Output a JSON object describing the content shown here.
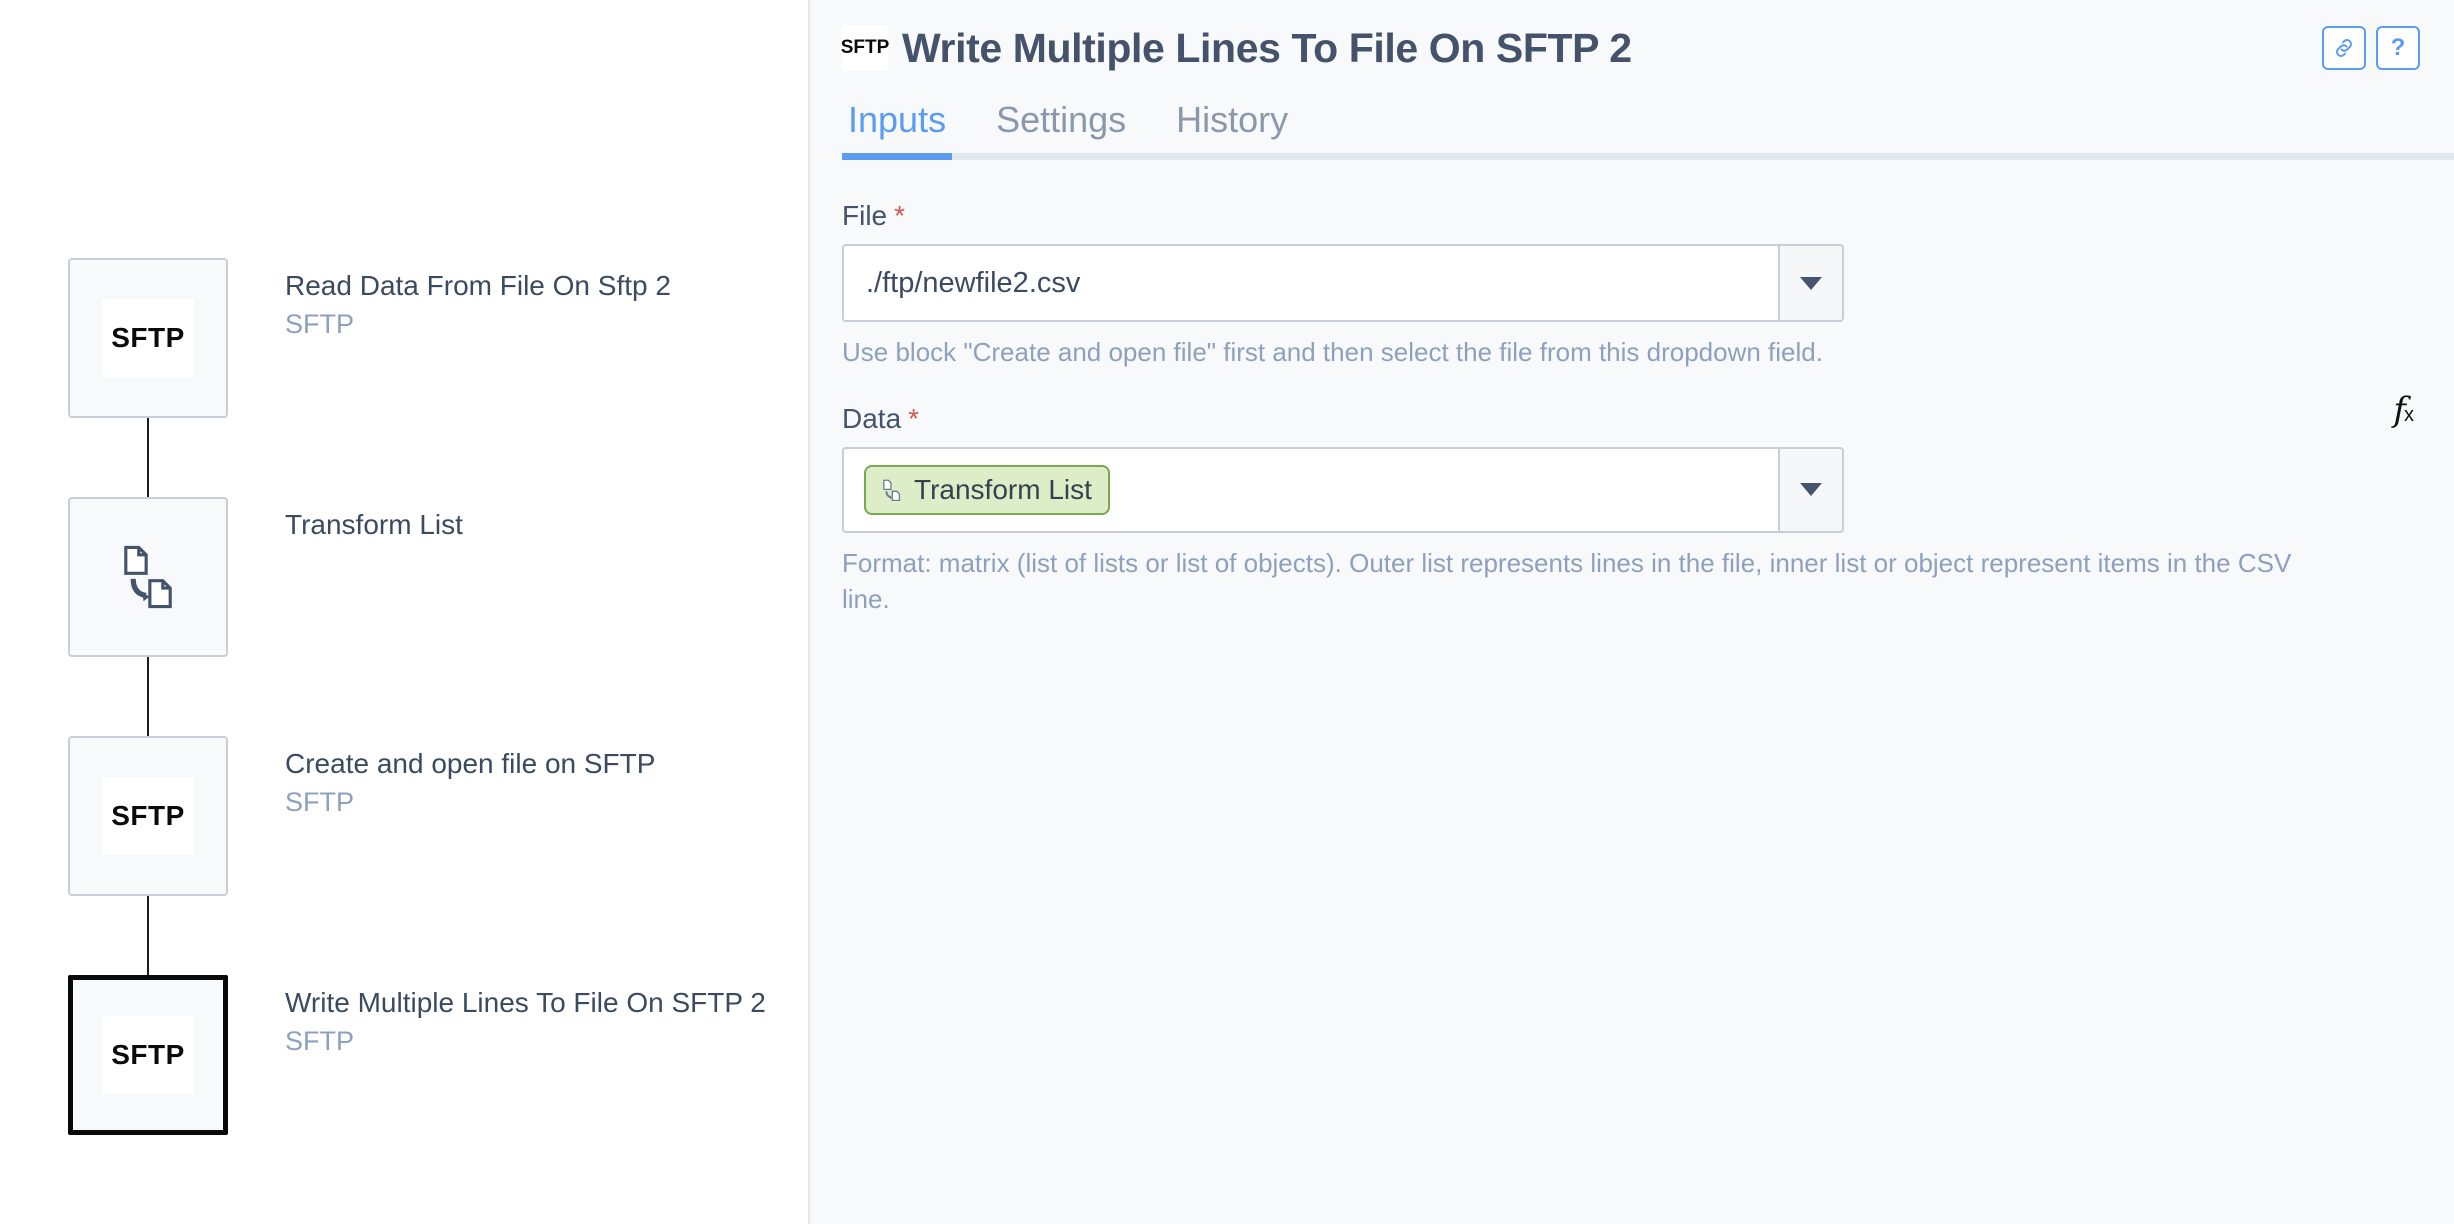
{
  "canvas": {
    "nodes": [
      {
        "icon": "sftp-badge-icon",
        "badge": "SFTP",
        "title": "Read Data From File On Sftp 2",
        "subtitle": "SFTP",
        "selected": false
      },
      {
        "icon": "transform-list-icon",
        "badge": "",
        "title": "Transform List",
        "subtitle": "",
        "selected": false
      },
      {
        "icon": "sftp-badge-icon",
        "badge": "SFTP",
        "title": "Create and open file on SFTP",
        "subtitle": "SFTP",
        "selected": false
      },
      {
        "icon": "sftp-badge-icon",
        "badge": "SFTP",
        "title": "Write Multiple Lines To File On SFTP 2",
        "subtitle": "SFTP",
        "selected": true
      }
    ]
  },
  "header": {
    "icon_label": "SFTP",
    "title": "Write Multiple Lines To File On SFTP 2",
    "actions": [
      {
        "name": "link-icon",
        "glyph": "link"
      },
      {
        "name": "help-icon",
        "glyph": "?"
      }
    ]
  },
  "tabs": [
    {
      "label": "Inputs",
      "active": true
    },
    {
      "label": "Settings",
      "active": false
    },
    {
      "label": "History",
      "active": false
    }
  ],
  "form": {
    "file": {
      "label": "File",
      "required_marker": "*",
      "value": "./ftp/newfile2.csv",
      "placeholder": "",
      "hint": "Use block \"Create and open file\" first and then select the file from this dropdown field."
    },
    "data": {
      "label": "Data",
      "required_marker": "*",
      "fx_label": "f",
      "fx_sub": "x",
      "chip_label": "Transform List",
      "hint": "Format: matrix (list of lists or list of objects). Outer list represents lines in the file, inner list or object represent items in the CSV line."
    }
  },
  "colors": {
    "accent": "#5b9bf0",
    "panel_bg": "#f8f9fa",
    "text": "#44536b",
    "muted": "#8ea0bd",
    "required": "#d9534f",
    "chip_bg": "#dcedc8",
    "chip_border": "#7aa84f"
  }
}
